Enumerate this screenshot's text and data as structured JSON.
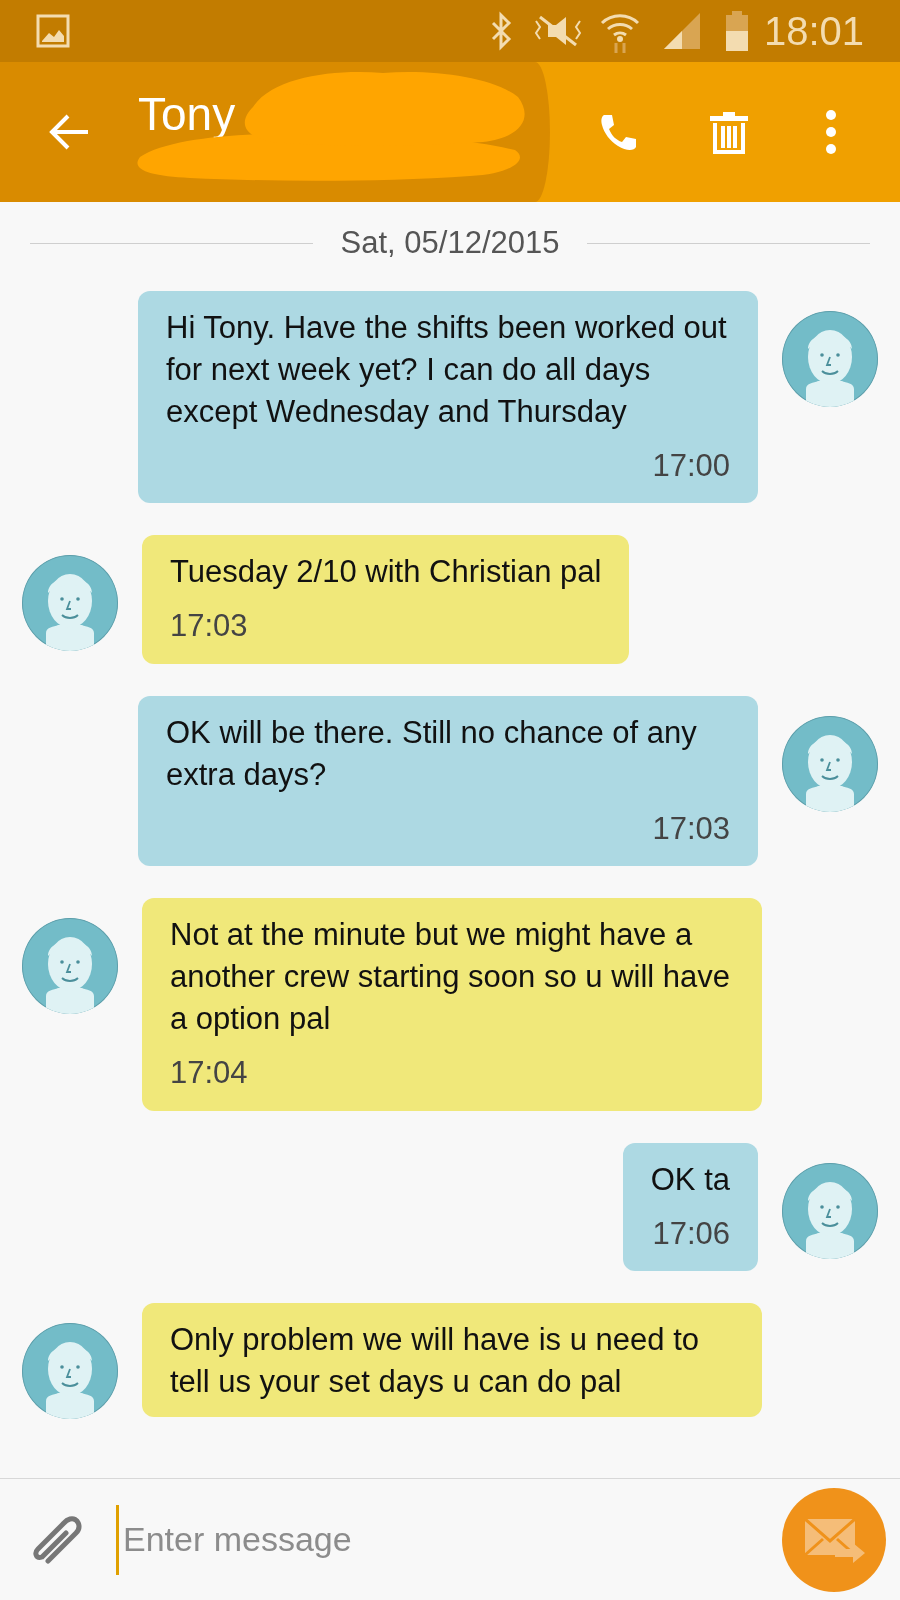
{
  "status_bar": {
    "time": "18:01"
  },
  "header": {
    "title": "Tony"
  },
  "date_divider": "Sat, 05/12/2015",
  "messages": [
    {
      "kind": "sent",
      "text": "Hi Tony. Have the shifts been worked out for next week yet? I can do all days except Wednesday and Thursday",
      "time": "17:00"
    },
    {
      "kind": "received",
      "text": "Tuesday 2/10 with Christian pal",
      "time": "17:03"
    },
    {
      "kind": "sent",
      "text": "OK will be there. Still no chance of any extra days?",
      "time": "17:03"
    },
    {
      "kind": "received",
      "text": "Not at the minute but we might have a another crew starting soon so u will have a option pal",
      "time": "17:04"
    },
    {
      "kind": "sent",
      "text": "OK ta",
      "time": "17:06"
    },
    {
      "kind": "received",
      "text": "Only problem we will have is u need to tell us your set days u can do pal"
    }
  ],
  "composer": {
    "placeholder": "Enter message"
  }
}
